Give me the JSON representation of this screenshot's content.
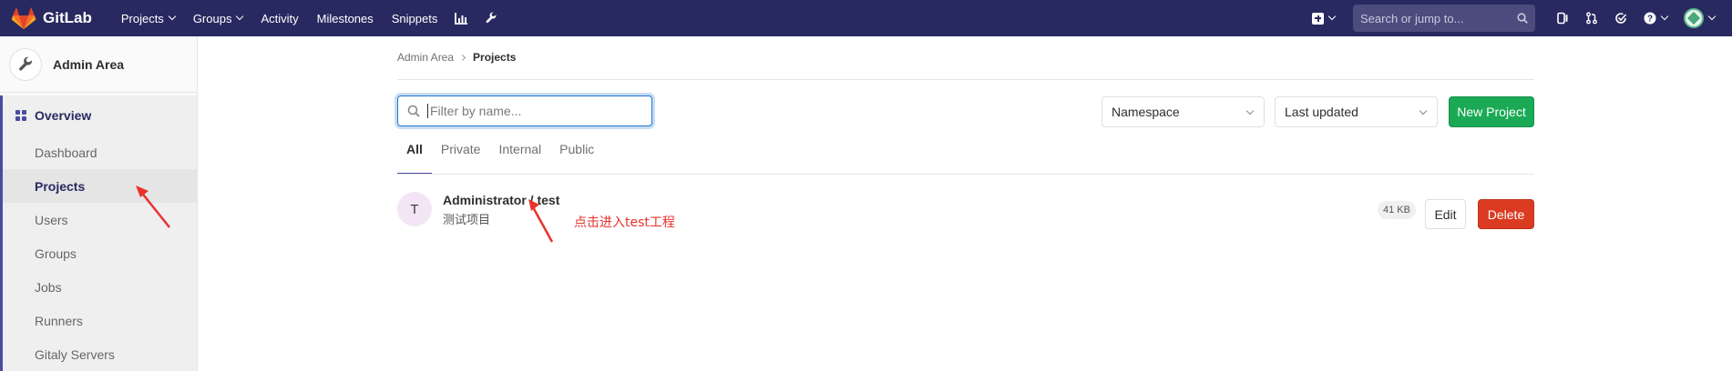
{
  "brand": {
    "name": "GitLab"
  },
  "topnav": {
    "links": [
      {
        "label": "Projects",
        "dropdown": true
      },
      {
        "label": "Groups",
        "dropdown": true
      },
      {
        "label": "Activity",
        "dropdown": false
      },
      {
        "label": "Milestones",
        "dropdown": false
      },
      {
        "label": "Snippets",
        "dropdown": false
      }
    ],
    "icons": [
      "chart-icon",
      "wrench-icon"
    ],
    "search_placeholder": "Search or jump to...",
    "right_icons": [
      "plus-icon",
      "issues-icon",
      "merge-request-icon",
      "todo-icon",
      "help-icon",
      "user-avatar"
    ],
    "colors": {
      "bg": "#292961"
    }
  },
  "sidebar": {
    "title": "Admin Area",
    "overview": "Overview",
    "items": [
      {
        "label": "Dashboard",
        "active": false
      },
      {
        "label": "Projects",
        "active": true
      },
      {
        "label": "Users",
        "active": false
      },
      {
        "label": "Groups",
        "active": false
      },
      {
        "label": "Jobs",
        "active": false
      },
      {
        "label": "Runners",
        "active": false
      },
      {
        "label": "Gitaly Servers",
        "active": false
      }
    ]
  },
  "breadcrumb": {
    "parent": "Admin Area",
    "current": "Projects"
  },
  "filter": {
    "placeholder": "Filter by name...",
    "value": ""
  },
  "selects": {
    "namespace": "Namespace",
    "sort": "Last updated"
  },
  "new_project_label": "New Project",
  "tabs": [
    {
      "label": "All",
      "active": true
    },
    {
      "label": "Private",
      "active": false
    },
    {
      "label": "Internal",
      "active": false
    },
    {
      "label": "Public",
      "active": false
    }
  ],
  "project": {
    "avatar_letter": "T",
    "name": "Administrator / test",
    "description": "测试项目",
    "size": "41 KB",
    "edit_label": "Edit",
    "delete_label": "Delete"
  },
  "annotation": {
    "text": "点击进入test工程",
    "color": "#e8322c"
  }
}
